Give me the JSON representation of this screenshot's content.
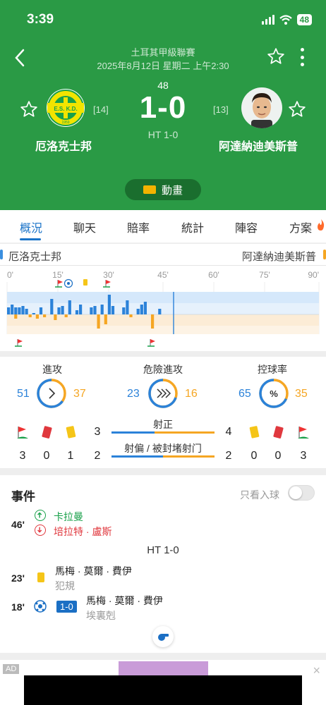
{
  "status": {
    "time": "3:39",
    "battery": "48"
  },
  "match": {
    "league": "土耳其甲級聯賽",
    "datetime": "2025年8月12日 星期二 上午2:30",
    "minute": "48",
    "score": "1-0",
    "halftime": "HT 1-0",
    "animation_label": "動畫"
  },
  "home": {
    "name": "厄洛克士邦",
    "rank": "[14]",
    "logo_text": "E.S. K.D.",
    "logo_year": "1959"
  },
  "away": {
    "name": "阿達納迪美斯普",
    "rank": "[13]"
  },
  "tabs": [
    "概況",
    "聊天",
    "賠率",
    "統計",
    "陣容",
    "方案"
  ],
  "timeline": {
    "home": "厄洛克士邦",
    "away": "阿達納迪美斯普",
    "ticks": [
      "0'",
      "15'",
      "30'",
      "45'",
      "60'",
      "75'",
      "90'"
    ]
  },
  "stats": {
    "attack": {
      "label": "進攻",
      "home": "51",
      "away": "37"
    },
    "danger": {
      "label": "危險進攻",
      "home": "23",
      "away": "16"
    },
    "possession": {
      "label": "控球率",
      "home": "65",
      "away": "35"
    },
    "home_counts": {
      "corners": "3",
      "red": "0",
      "yellow": "1",
      "shots_on": "3",
      "shots_off": "2"
    },
    "away_counts": {
      "shots_on": "4",
      "yellow": "0",
      "red": "0",
      "corners": "3",
      "shots_off": "2"
    },
    "shots_on_label": "射正",
    "shots_off_label": "射偏 / 被封堵射门"
  },
  "events": {
    "title": "事件",
    "goals_only_label": "只看入球",
    "ht": "HT 1-0",
    "sub": {
      "minute": "46'",
      "in": "卡拉曼",
      "out": "培拉特 · 盧斯"
    },
    "card": {
      "minute": "23'",
      "player": "馬梅 · 莫爾 · 費伊",
      "reason": "犯規"
    },
    "goal": {
      "minute": "18'",
      "score": "1-0",
      "player": "馬梅 · 莫爾 · 費伊",
      "detail": "埃裏剋"
    }
  },
  "ad": {
    "label": "AD",
    "close": "×"
  },
  "colors": {
    "header": "#2a9a45",
    "home": "#2b82d9",
    "away": "#f5a623",
    "accent": "#1a73c8"
  }
}
